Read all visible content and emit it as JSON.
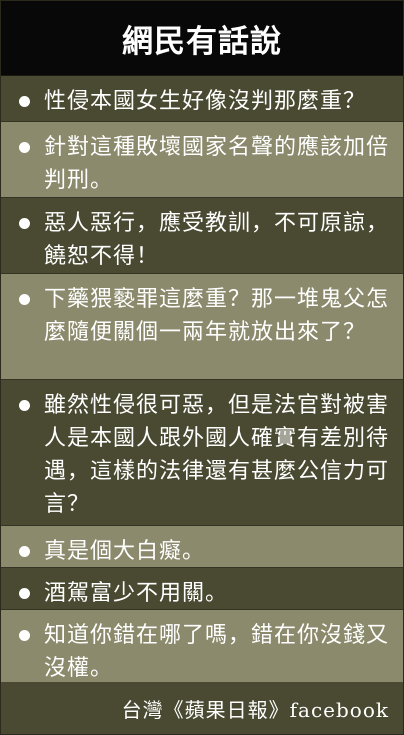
{
  "title": "網民有話說",
  "comments": [
    {
      "text": "性侵本國女生好像沒判那麼重？"
    },
    {
      "text": "針對這種敗壞國家名聲的應該加倍判刑。"
    },
    {
      "text": "惡人惡行，應受教訓，不可原諒，饒恕不得！"
    },
    {
      "text": "下藥猥褻罪這麼重？那一堆鬼父怎麼隨便關個一兩年就放出來了？"
    },
    {
      "text": "雖然性侵很可惡，但是法官對被害人是本國人跟外國人確實有差別待遇，這樣的法律還有甚麼公信力可言？"
    },
    {
      "text": "真是個大白癡。"
    },
    {
      "text": "酒駕富少不用關。"
    },
    {
      "text": "知道你錯在哪了嗎，錯在你沒錢又沒權。"
    }
  ],
  "credit": "台灣《蘋果日報》facebook",
  "colors": {
    "title_bg": "#080808",
    "row_dark": "#4a4a32",
    "row_light": "#8c8a6c",
    "text": "#ffffff"
  }
}
